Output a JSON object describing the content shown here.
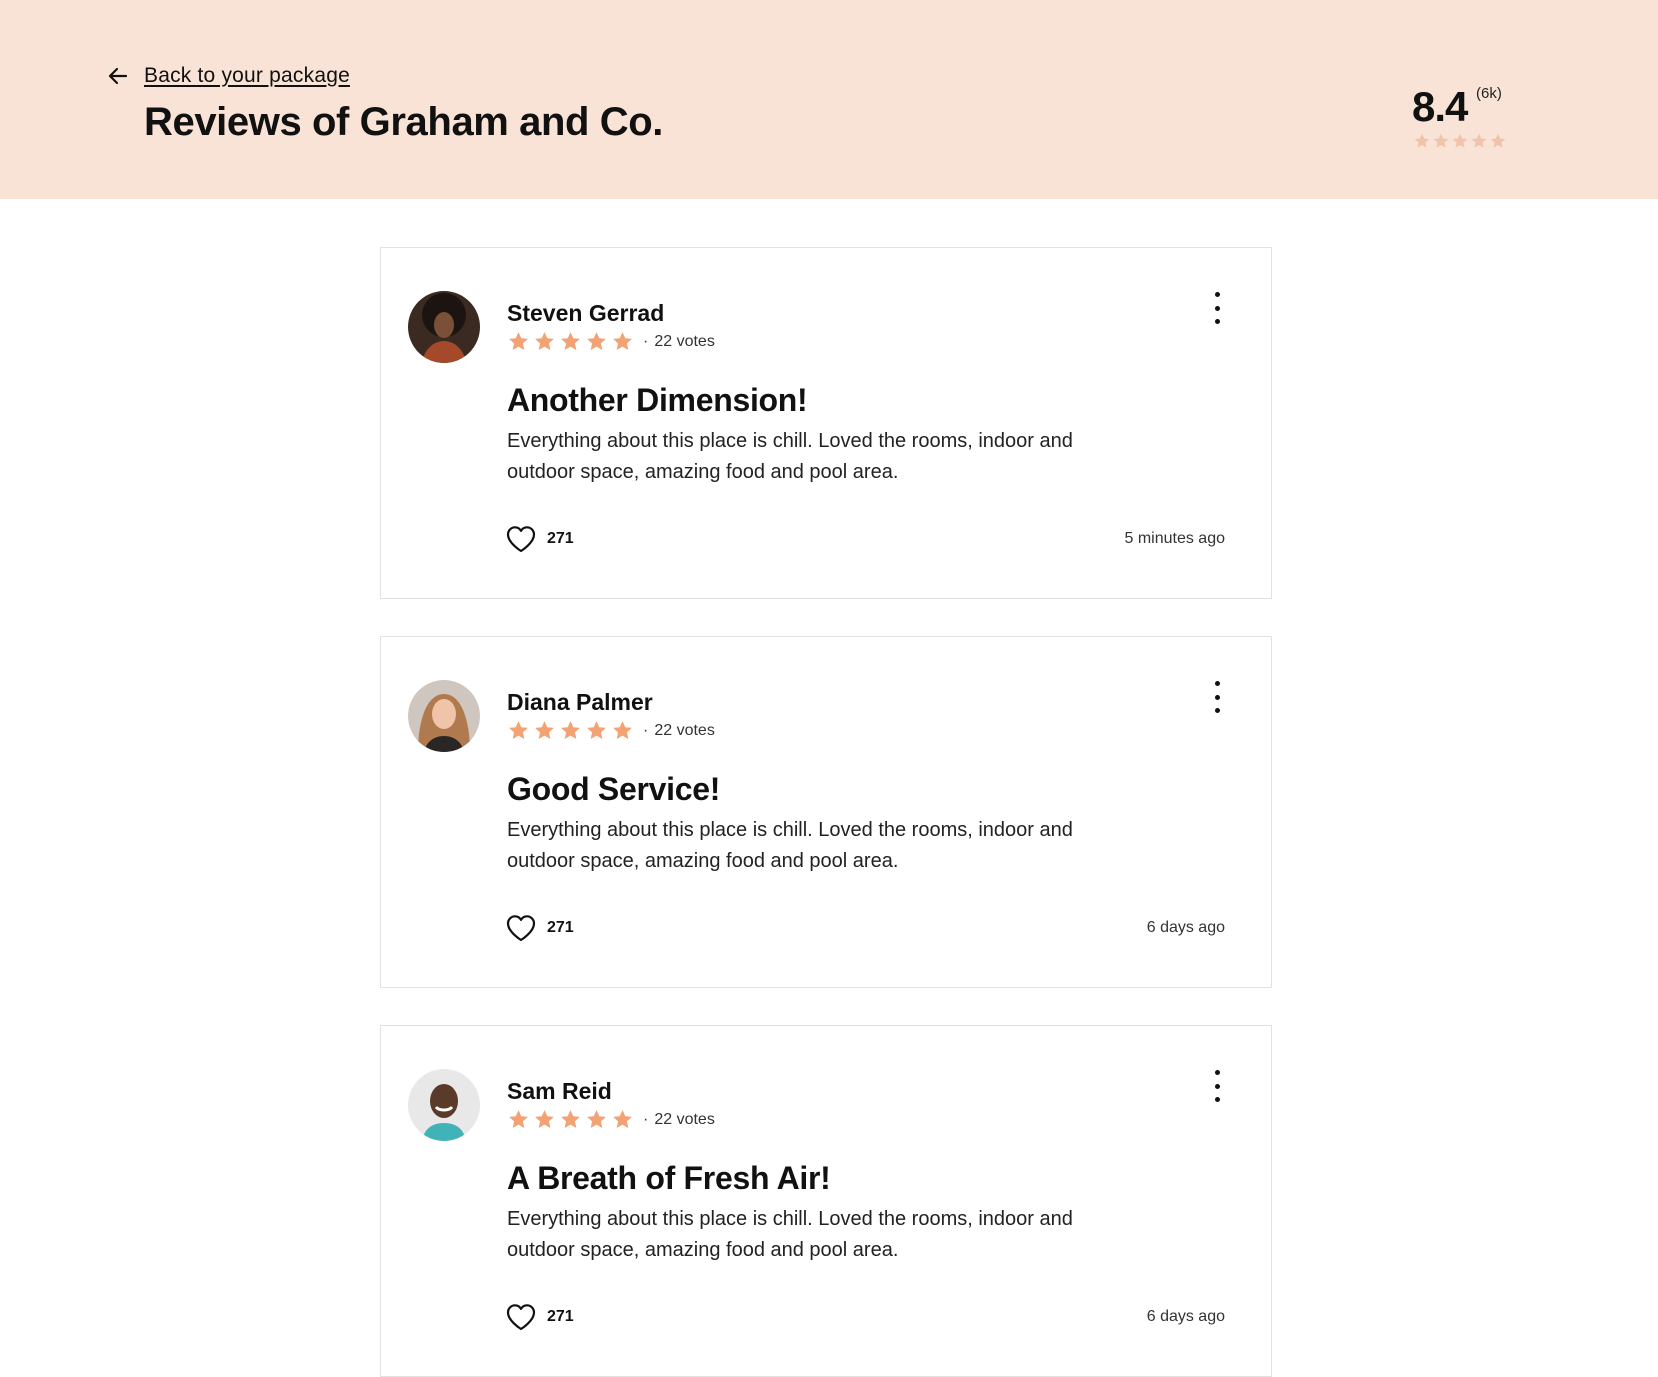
{
  "header": {
    "back_label": "Back to your package",
    "title": "Reviews of Graham and Co.",
    "rating": "8.4",
    "rating_count": "(6k)",
    "rating_stars": 5,
    "rating_star_color": "#f0c4ab"
  },
  "colors": {
    "header_bg": "#f9e3d6",
    "star": "#f2a273"
  },
  "reviews": [
    {
      "name": "Steven Gerrad",
      "stars": 5,
      "dot": "·",
      "votes": "22 votes",
      "title": "Another Dimension!",
      "body": "Everything about this place is chill. Loved the rooms, indoor and outdoor space, amazing food and pool area.",
      "likes": "271",
      "time": "5 minutes ago"
    },
    {
      "name": "Diana Palmer",
      "stars": 5,
      "dot": "·",
      "votes": "22 votes",
      "title": "Good Service!",
      "body": "Everything about this place is chill. Loved the rooms, indoor and outdoor space, amazing food and pool area.",
      "likes": "271",
      "time": "6 days ago"
    },
    {
      "name": "Sam Reid",
      "stars": 5,
      "dot": "·",
      "votes": "22 votes",
      "title": "A Breath of Fresh Air!",
      "body": "Everything about this place is chill. Loved the rooms, indoor and outdoor space, amazing food and pool area.",
      "likes": "271",
      "time": "6 days ago"
    }
  ]
}
